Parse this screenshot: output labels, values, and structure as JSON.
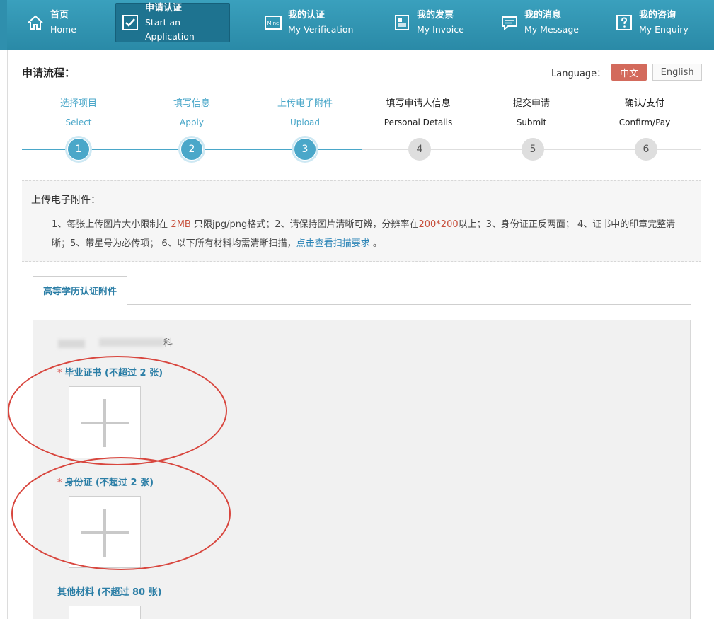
{
  "nav": {
    "items": [
      {
        "cn": "首页",
        "en": "Home",
        "icon": "home-icon"
      },
      {
        "cn": "申请认证",
        "en": "Start an Application",
        "icon": "checkbox-icon",
        "active": true
      },
      {
        "cn": "我的认证",
        "en": "My Verification",
        "icon": "certificate-icon",
        "icon_text": "Mine"
      },
      {
        "cn": "我的发票",
        "en": "My Invoice",
        "icon": "invoice-icon"
      },
      {
        "cn": "我的消息",
        "en": "My Message",
        "icon": "message-icon"
      },
      {
        "cn": "我的咨询",
        "en": "My Enquiry",
        "icon": "question-icon"
      }
    ]
  },
  "page": {
    "title": "申请流程："
  },
  "language": {
    "label": "Language：",
    "zh": "中文",
    "en": "English"
  },
  "steps": [
    {
      "cn": "选择项目",
      "en": "Select",
      "num": "1",
      "state": "done"
    },
    {
      "cn": "填写信息",
      "en": "Apply",
      "num": "2",
      "state": "done"
    },
    {
      "cn": "上传电子附件",
      "en": "Upload",
      "num": "3",
      "state": "done"
    },
    {
      "cn": "填写申请人信息",
      "en": "Personal Details",
      "num": "4",
      "state": "todo"
    },
    {
      "cn": "提交申请",
      "en": "Submit",
      "num": "5",
      "state": "todo"
    },
    {
      "cn": "确认/支付",
      "en": "Confirm/Pay",
      "num": "6",
      "state": "todo"
    }
  ],
  "notice": {
    "title": "上传电子附件：",
    "p1": "1、每张上传图片大小限制在",
    "size": "2MB",
    "p2": "只限jpg/png格式；2、请保持图片清晰可辨，分辨率在",
    "res": "200*200",
    "p3": "以上；3、身份证正反两面； 4、证书中的印章完整清晰；5、带星号为必传项； 6、以下所有材料均需清晰扫描，",
    "link": "点击查看扫描要求",
    "end": "。"
  },
  "tab": {
    "label": "高等学历认证附件"
  },
  "panel": {
    "blurred_tail": "科",
    "fields": [
      {
        "required_mark": "*",
        "label": "毕业证书 (不超过 2 张)"
      },
      {
        "required_mark": "*",
        "label": "身份证 (不超过 2 张)"
      },
      {
        "required_mark": "",
        "label": "其他材料 (不超过 80 张)"
      }
    ]
  },
  "annotation_color": "#d8463e",
  "accent_color": "#4aa7c9"
}
